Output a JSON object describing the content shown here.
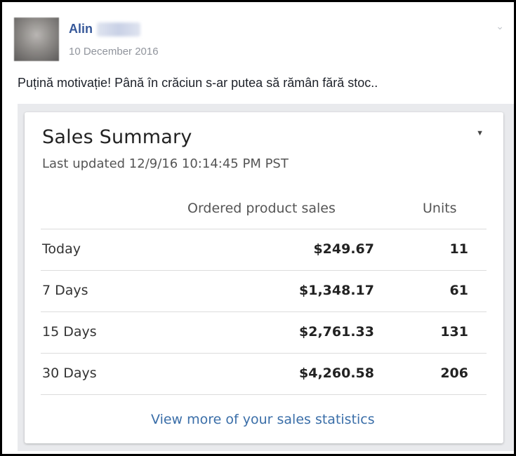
{
  "post": {
    "author_name": "Alin",
    "date": "10 December 2016",
    "text": "Puțină motivație! Până în crăciun s-ar putea să rămân fără stoc.."
  },
  "card": {
    "title": "Sales Summary",
    "subtitle": "Last updated 12/9/16 10:14:45 PM PST",
    "columns": {
      "sales": "Ordered product sales",
      "units": "Units"
    },
    "rows": [
      {
        "label": "Today",
        "sales": "$249.67",
        "units": "11"
      },
      {
        "label": "7 Days",
        "sales": "$1,348.17",
        "units": "61"
      },
      {
        "label": "15 Days",
        "sales": "$2,761.33",
        "units": "131"
      },
      {
        "label": "30 Days",
        "sales": "$4,260.58",
        "units": "206"
      }
    ],
    "link": "View more of your sales statistics"
  },
  "icons": {
    "post_menu": "chevron-down-icon",
    "card_menu": "caret-down-icon"
  },
  "colors": {
    "author_link": "#365899",
    "stats_link": "#3a6ea8"
  }
}
